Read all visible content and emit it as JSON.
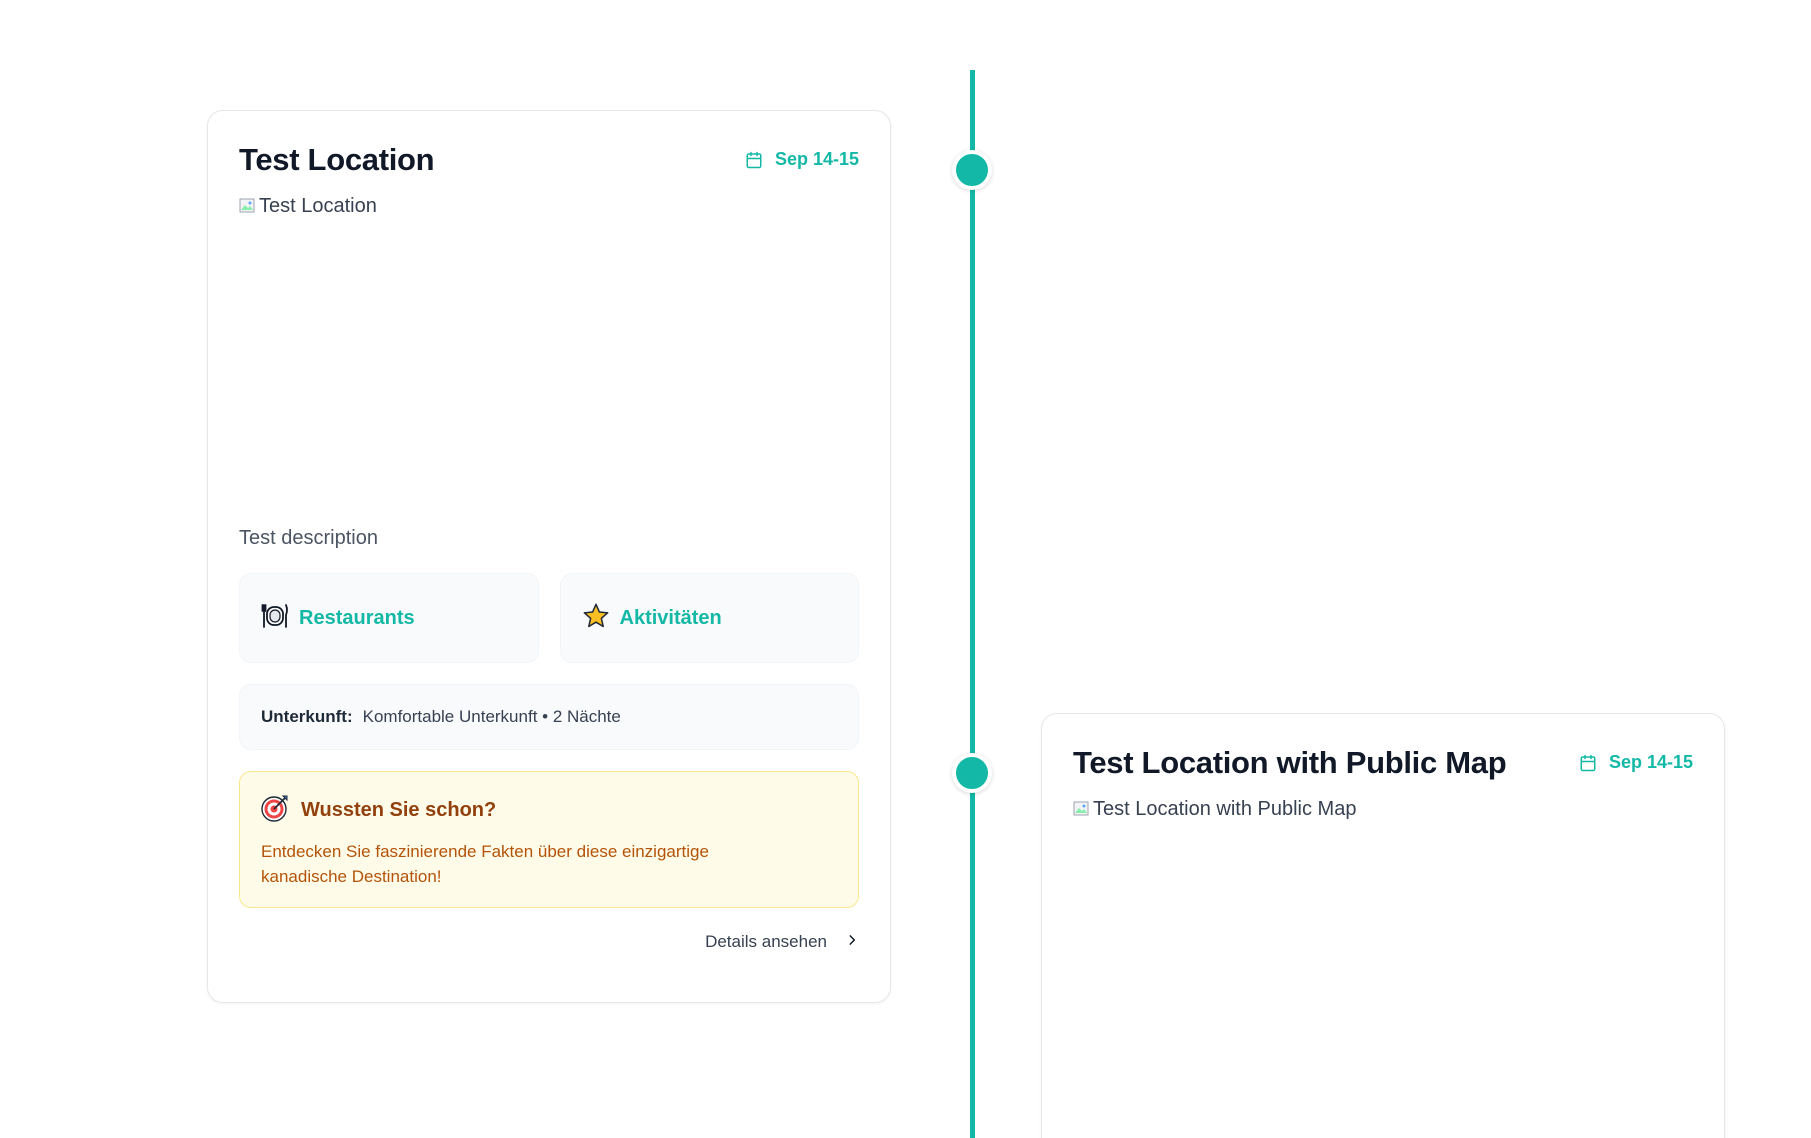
{
  "timeline": {
    "accent_color": "#14b8a6"
  },
  "cards": [
    {
      "title": "Test Location",
      "date": "Sep 14-15",
      "date_icon": "calendar-icon",
      "image_alt": "Test Location",
      "description": "Test description",
      "quick_links": [
        {
          "label": "Restaurants",
          "icon": "plate-cutlery-icon"
        },
        {
          "label": "Aktivitäten",
          "icon": "star-icon"
        }
      ],
      "accommodation": {
        "label": "Unterkunft:",
        "value": "Komfortable Unterkunft • 2 Nächte"
      },
      "fact": {
        "icon": "target-icon",
        "title": "Wussten Sie schon?",
        "text": "Entdecken Sie faszinierende Fakten über diese einzigartige kanadische Destination!"
      },
      "details_label": "Details ansehen",
      "details_icon": "chevron-right-icon"
    },
    {
      "title": "Test Location with Public Map",
      "date": "Sep 14-15",
      "date_icon": "calendar-icon",
      "image_alt": "Test Location with Public Map"
    }
  ]
}
